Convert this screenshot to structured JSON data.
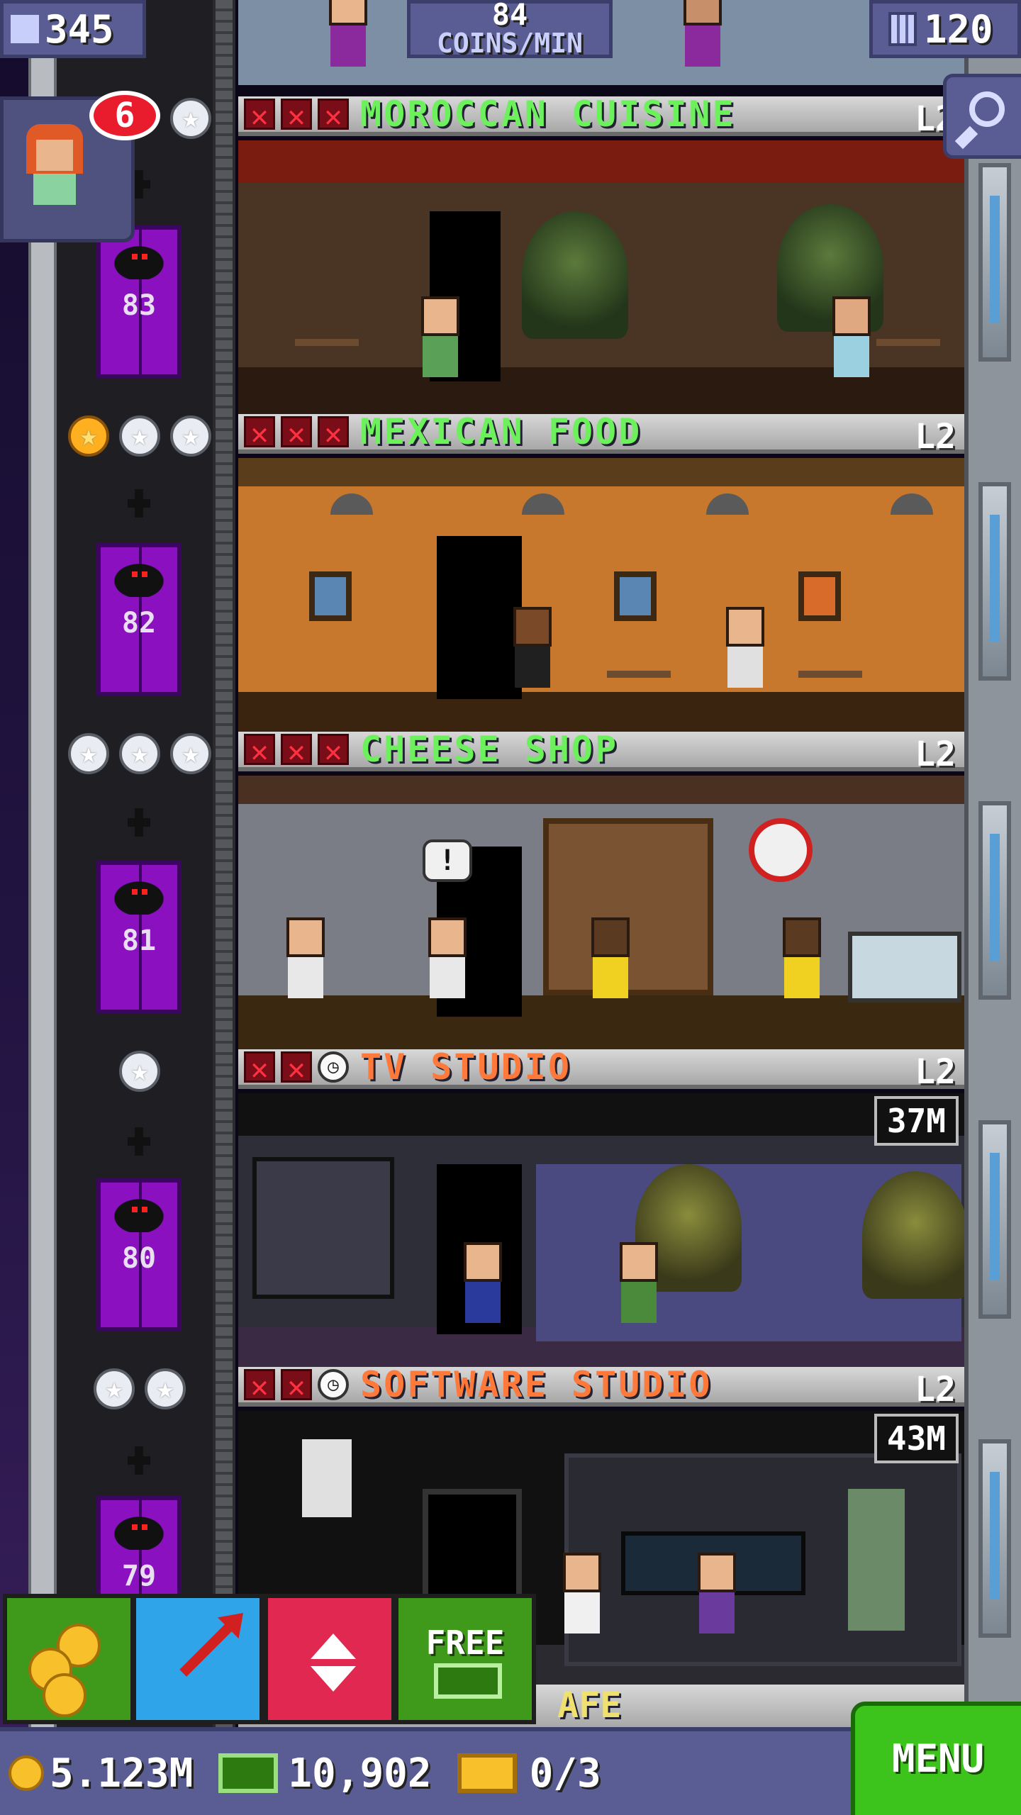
{
  "top_bar": {
    "population": "345",
    "coins_per_min_value": "84",
    "coins_per_min_label": "COINS/MIN",
    "floors": "120"
  },
  "bitizen_notification": {
    "count": "6"
  },
  "floors": [
    {
      "number": "83",
      "name": "MOROCCAN CUISINE",
      "level": "L2",
      "status": [
        "x",
        "x",
        "x"
      ],
      "name_color": "green",
      "timer": "",
      "stars": [
        "silver"
      ]
    },
    {
      "number": "82",
      "name": "MEXICAN FOOD",
      "level": "L2",
      "status": [
        "x",
        "x",
        "x"
      ],
      "name_color": "green",
      "timer": "",
      "stars": [
        "gold",
        "silver",
        "silver"
      ]
    },
    {
      "number": "81",
      "name": "CHEESE SHOP",
      "level": "L2",
      "status": [
        "x",
        "x",
        "x"
      ],
      "name_color": "green",
      "timer": "",
      "stars": [
        "silver",
        "silver",
        "silver"
      ]
    },
    {
      "number": "80",
      "name": "TV STUDIO",
      "level": "L2",
      "status": [
        "x",
        "x",
        "clock"
      ],
      "name_color": "orange",
      "timer": "37M",
      "stars": [
        "silver"
      ]
    },
    {
      "number": "79",
      "name": "SOFTWARE STUDIO",
      "level": "L2",
      "status": [
        "x",
        "x",
        "clock"
      ],
      "name_color": "orange",
      "timer": "43M",
      "stars": [
        "silver",
        "silver"
      ]
    }
  ],
  "partial_floor_name": "AFE",
  "action_buttons": {
    "free_label": "FREE"
  },
  "status_bar": {
    "coins": "5.123M",
    "bux": "10,902",
    "tickets": "0/3",
    "menu_label": "MENU"
  },
  "icons": [
    "population-icon",
    "building-icon",
    "search-icon",
    "coin-icon",
    "bux-icon",
    "ticket-icon",
    "star-icon",
    "clock-icon"
  ]
}
